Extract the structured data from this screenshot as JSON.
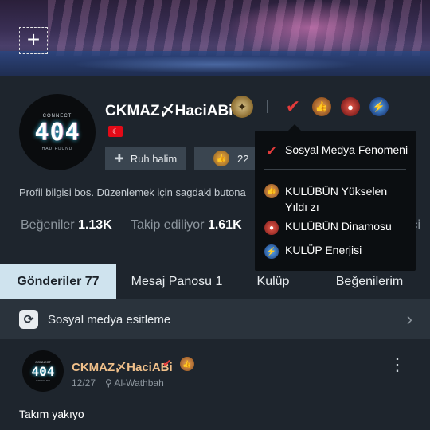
{
  "banner": {
    "add_icon": "plus-icon",
    "add_glyph": "+"
  },
  "profile": {
    "avatar": {
      "top": "CONNECT",
      "main": "404",
      "bottom": "HAD FOUND"
    },
    "name": "CKMAZ〆HaciABi",
    "flag": "turkey-flag-icon",
    "badges": [
      "rank-emblem-icon",
      "verified-icon",
      "club-rising-star-icon",
      "club-dynamo-icon",
      "club-energy-icon"
    ],
    "mood_label": "Ruh halim",
    "likes_count": "22",
    "bio": "Profil bilgisi bos. Düzenlemek için sagdaki butona",
    "stats": {
      "likes_label": "Beğeniler",
      "likes_value": "1.13K",
      "following_label": "Takip ediliyor",
      "following_value": "1.61K",
      "followers_label_partial": "tçi"
    }
  },
  "tooltip": {
    "items": [
      {
        "icon": "verified-icon",
        "label": "Sosyal Medya Fenomeni"
      },
      {
        "icon": "club-rising-star-icon",
        "label": "KULÜBÜN Yükselen Yıldı zı"
      },
      {
        "icon": "club-dynamo-icon",
        "label": "KULÜBÜN Dinamosu"
      },
      {
        "icon": "club-energy-icon",
        "label": "KULÜP Enerjisi"
      }
    ]
  },
  "tabs": [
    {
      "label": "Gönderiler 77",
      "active": true
    },
    {
      "label": "Mesaj Panosu 1",
      "active": false
    },
    {
      "label": "Kulüp",
      "active": false
    },
    {
      "label": "Beğenilerim",
      "active": false
    }
  ],
  "sync": {
    "icon": "sync-icon",
    "label": "Sosyal medya esitleme",
    "chevron": "chevron-right-icon"
  },
  "post": {
    "author": "CKMAZ〆HaciABi",
    "date": "12/27",
    "location": "Al-Wathbah",
    "text": "Takım yakıyo",
    "more_icon": "more-vertical-icon"
  },
  "colors": {
    "active_tab_bg": "#cfe3ee",
    "verified_red": "#e23b3b",
    "author_name": "#f0c08a"
  }
}
